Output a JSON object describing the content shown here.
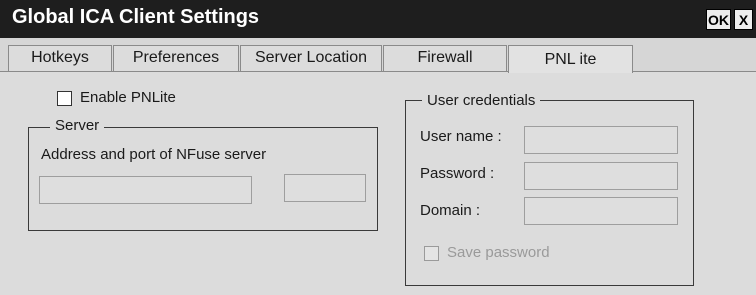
{
  "window": {
    "title": "Global ICA Client Settings",
    "ok_label": "OK",
    "close_label": "X"
  },
  "tabs": [
    {
      "label": "Hotkeys",
      "active": false
    },
    {
      "label": "Preferences",
      "active": false
    },
    {
      "label": "Server Location",
      "active": false
    },
    {
      "label": "Firewall",
      "active": false
    },
    {
      "label": "PNL ite",
      "active": true
    }
  ],
  "pnlite": {
    "enable_label": "Enable PNLite",
    "enable_checked": false
  },
  "server": {
    "legend": "Server",
    "description": "Address and port of NFuse server",
    "address_value": "",
    "port_value": ""
  },
  "credentials": {
    "legend": "User credentials",
    "username_label": "User name :",
    "username_value": "",
    "password_label": "Password :",
    "password_value": "",
    "domain_label": "Domain :",
    "domain_value": "",
    "save_password_label": "Save password",
    "save_password_checked": false,
    "save_password_enabled": false
  }
}
